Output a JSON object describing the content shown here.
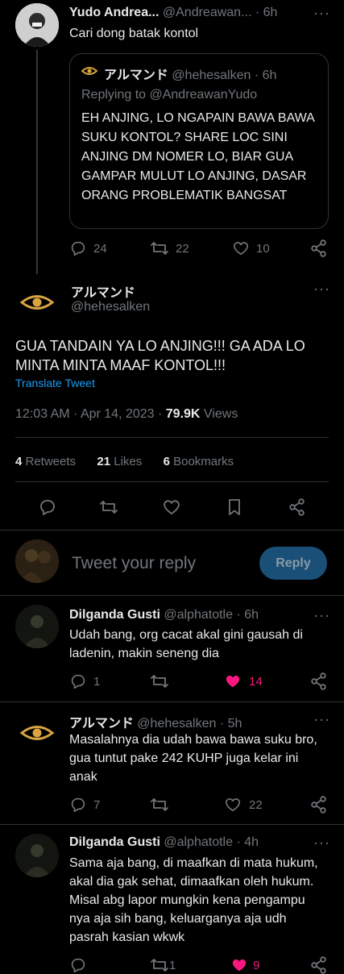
{
  "tweet1": {
    "name": "Yudo Andrea...",
    "handle": "@Andreawan...",
    "time": "· 6h",
    "text": "Cari dong batak kontol",
    "quote": {
      "name": "アルマンド",
      "handle": "@hehesalken · 6h",
      "replying": "Replying to @AndreawanYudo",
      "text": "EH ANJING, LO NGAPAIN BAWA BAWA SUKU KONTOL? SHARE LOC SINI ANJING DM NOMER LO, BIAR GUA GAMPAR MULUT LO ANJING, DASAR ORANG PROBLEMATIK BANGSAT"
    },
    "replies": "24",
    "retweets": "22",
    "likes": "10"
  },
  "main": {
    "name": "アルマンド",
    "handle": "@hehesalken",
    "text": "GUA TANDAIN YA LO ANJING!!! GA ADA LO MINTA MINTA MAAF KONTOL!!!",
    "translate": "Translate Tweet",
    "timestamp": "12:03 AM · Apr 14, 2023 · ",
    "views_count": "79.9K",
    "views_label": " Views",
    "retweets_count": "4",
    "retweets_label": " Retweets",
    "likes_count": "21",
    "likes_label": " Likes",
    "bookmarks_count": "6",
    "bookmarks_label": " Bookmarks"
  },
  "composer": {
    "placeholder": "Tweet your reply",
    "button": "Reply"
  },
  "reply1": {
    "name": "Dilganda Gusti",
    "handle": "@alphatotle",
    "time": "· 6h",
    "text": "Udah bang, org cacat akal gini gausah di ladenin, makin seneng dia",
    "replies": "1",
    "retweets": "",
    "likes": "14"
  },
  "reply2": {
    "name": "アルマンド",
    "handle": "@hehesalken",
    "time": "· 5h",
    "text": "Masalahnya dia udah bawa bawa suku bro, gua tuntut pake 242 KUHP juga kelar ini anak",
    "replies": "7",
    "retweets": "",
    "likes": "22"
  },
  "reply3": {
    "name": "Dilganda Gusti",
    "handle": "@alphatotle",
    "time": "· 4h",
    "text": "Sama aja bang, di maafkan di mata hukum, akal dia gak sehat, dimaafkan oleh hukum. Misal abg lapor mungkin kena pengampu nya aja sih bang, keluarganya aja udh pasrah kasian wkwk",
    "replies": "",
    "retweets": "1",
    "likes": "9"
  },
  "colors": {
    "background": "#000000",
    "text": "#e7e9ea",
    "muted": "#71767b",
    "link": "#1d9bf0",
    "like_active": "#f91880",
    "reply_button": "#1a4f78",
    "divider": "#2f3336"
  }
}
